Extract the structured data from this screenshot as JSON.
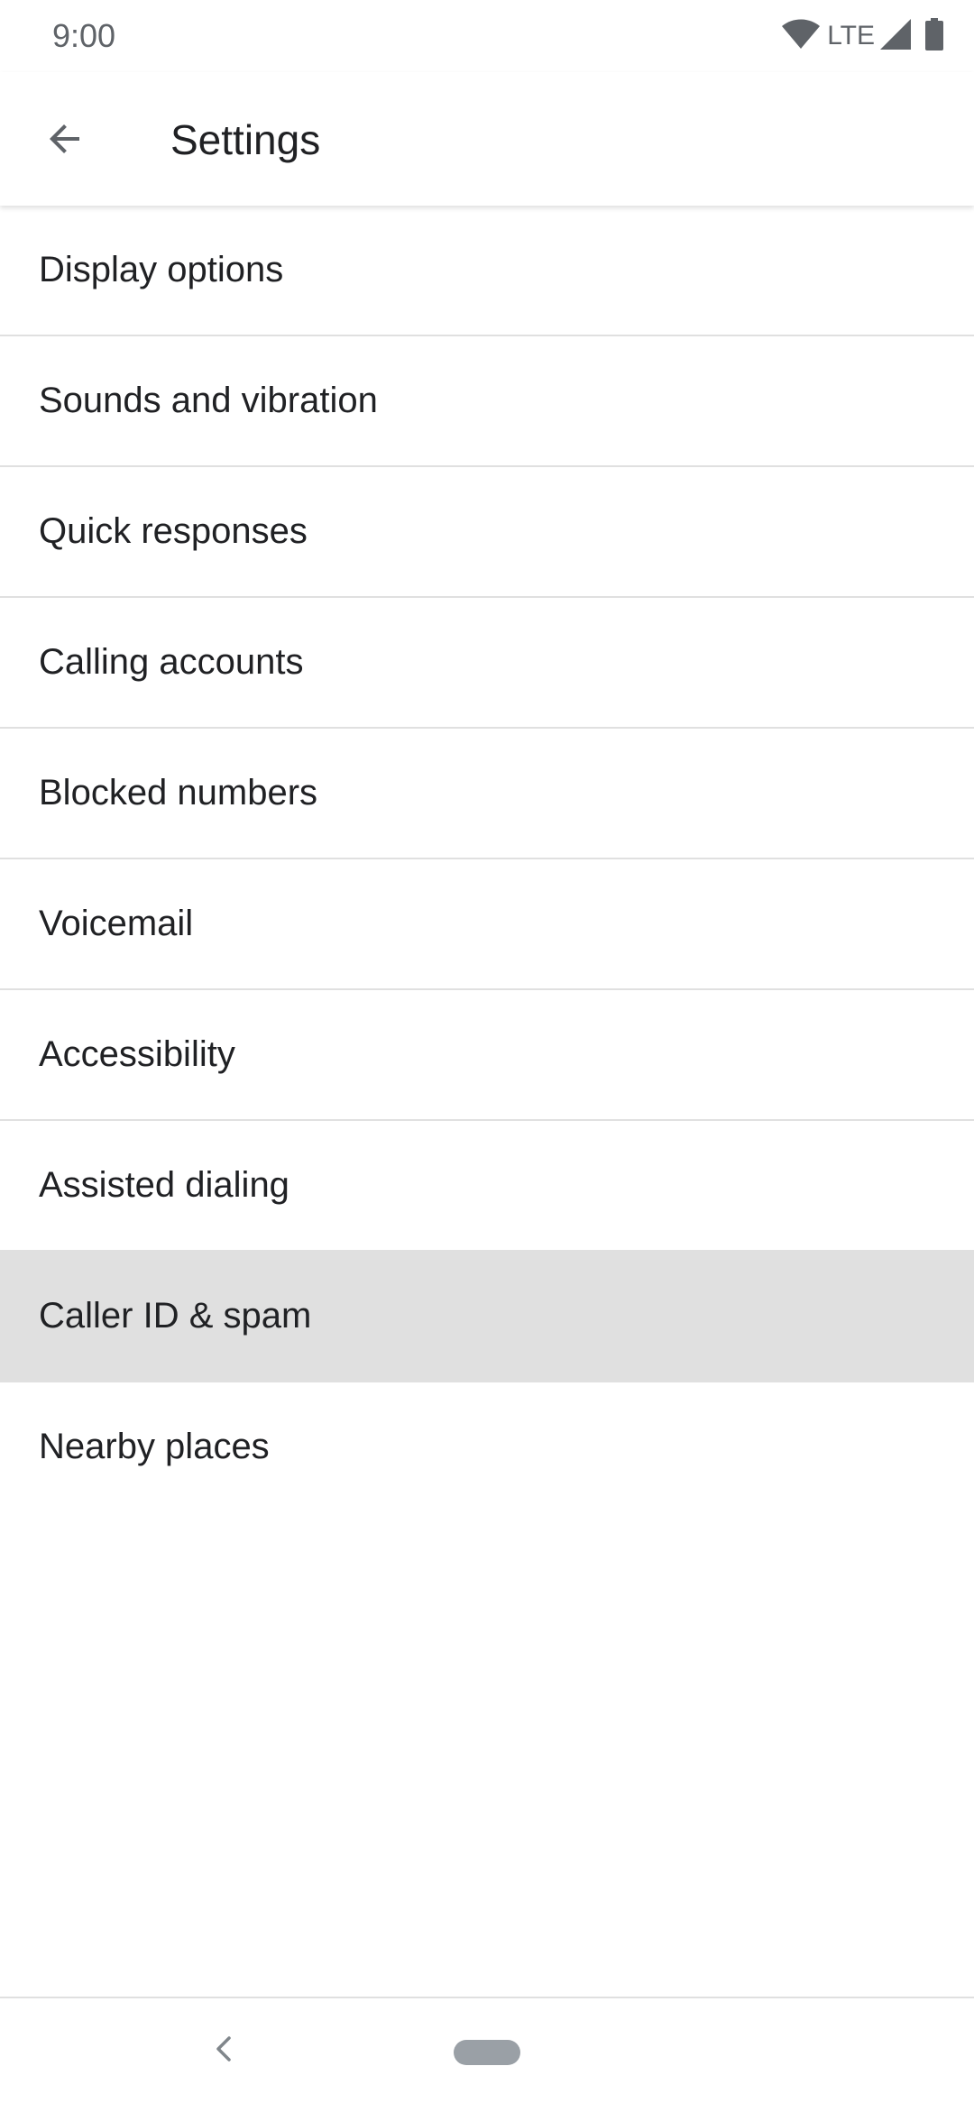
{
  "status_bar": {
    "time": "9:00",
    "network": "LTE",
    "icons": [
      "wifi-icon",
      "cell-signal-icon",
      "battery-icon"
    ]
  },
  "app_bar": {
    "title": "Settings",
    "back_icon": "arrow-back-icon"
  },
  "settings": {
    "items": [
      {
        "label": "Display options"
      },
      {
        "label": "Sounds and vibration"
      },
      {
        "label": "Quick responses"
      },
      {
        "label": "Calling accounts"
      },
      {
        "label": "Blocked numbers"
      },
      {
        "label": "Voicemail"
      },
      {
        "label": "Accessibility"
      },
      {
        "label": "Assisted dialing"
      },
      {
        "label": "Caller ID & spam",
        "selected": true
      },
      {
        "label": "Nearby places"
      }
    ]
  },
  "nav_bar": {
    "icons": [
      "nav-back-icon",
      "home-pill-icon"
    ]
  },
  "colors": {
    "text_primary": "#202124",
    "text_secondary": "#5f6368",
    "divider": "#e0e0e0",
    "selected_row": "#e0e0e0",
    "background": "#ffffff"
  }
}
